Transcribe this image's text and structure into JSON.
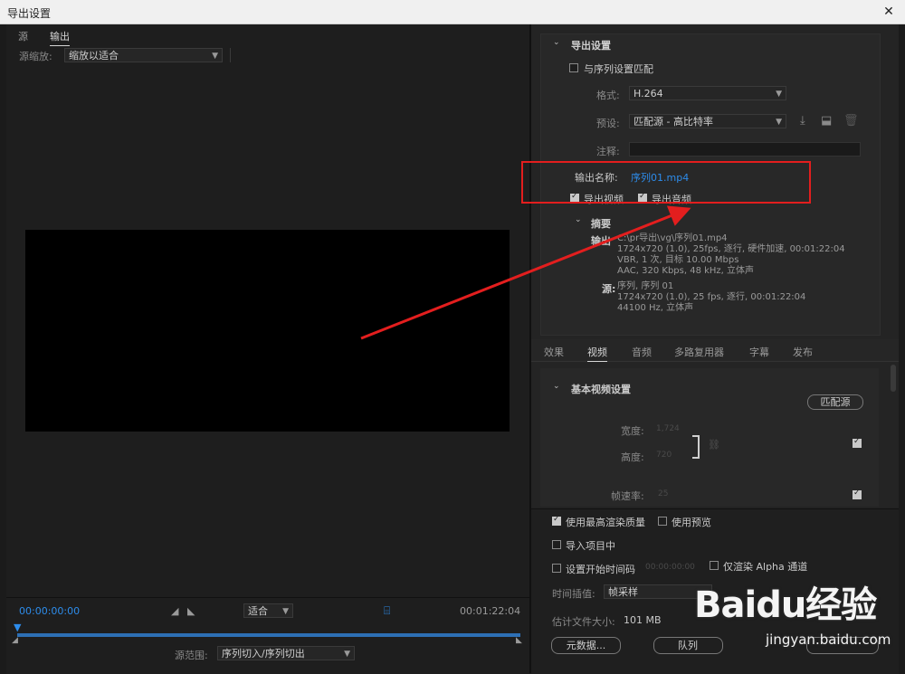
{
  "window": {
    "title": "导出设置",
    "close": "✕"
  },
  "left": {
    "tabs": [
      "源",
      "输出"
    ],
    "zoom_label": "源缩放:",
    "zoom_value": "缩放以适合",
    "timecode_start": "00:00:00:00",
    "fit_value": "适合",
    "timecode_end": "00:01:22:04",
    "range_label": "源范围:",
    "range_value": "序列切入/序列切出"
  },
  "export": {
    "section_title": "导出设置",
    "match_sequence": "与序列设置匹配",
    "format_label": "格式:",
    "format_value": "H.264",
    "preset_label": "预设:",
    "preset_value": "匹配源 - 高比特率",
    "comment_label": "注释:",
    "output_name_label": "输出名称:",
    "output_name_value": "序列01.mp4",
    "export_video": "导出视频",
    "export_audio": "导出音频",
    "summary_title": "摘要",
    "summary_output_label": "输出",
    "summary_output_lines": [
      "C:\\pr导出\\vg\\序列01.mp4",
      "1724x720 (1.0), 25fps, 逐行, 硬件加速, 00:01:22:04",
      "VBR, 1 次, 目标 10.00 Mbps",
      "AAC, 320 Kbps, 48 kHz, 立体声"
    ],
    "summary_source_label": "源:",
    "summary_source_lines": [
      "序列, 序列 01",
      "1724x720 (1.0), 25 fps, 逐行, 00:01:22:04",
      "44100 Hz, 立体声"
    ]
  },
  "tabs2": [
    "效果",
    "视频",
    "音频",
    "多路复用器",
    "字幕",
    "发布"
  ],
  "video": {
    "section_title": "基本视频设置",
    "match_source_btn": "匹配源",
    "width_label": "宽度:",
    "width_value": "1,724",
    "height_label": "高度:",
    "height_value": "720",
    "framerate_label": "帧速率:",
    "framerate_value": "25"
  },
  "bottom": {
    "max_render": "使用最高渲染质量",
    "use_preview": "使用预览",
    "import_project": "导入项目中",
    "set_timecode": "设置开始时间码",
    "timecode_val": "00:00:00:00",
    "alpha_only": "仅渲染 Alpha 通道",
    "interp_label": "时间插值:",
    "interp_value": "帧采样",
    "filesize_label": "估计文件大小:",
    "filesize_value": "101 MB",
    "metadata_btn": "元数据...",
    "queue_btn": "队列"
  },
  "watermark": {
    "text": "Baidu经验",
    "url": "jingyan.baidu.com"
  },
  "colors": {
    "accent_blue": "#2d8ceb",
    "highlight_red": "#e31e1e"
  }
}
